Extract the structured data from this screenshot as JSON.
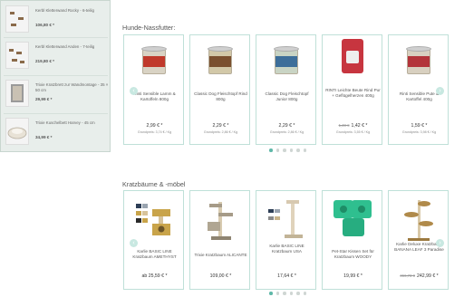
{
  "sidebar": {
    "items": [
      {
        "name": "Kerbl Kletterwand Rocky - 6-teilig",
        "price": "106,80 € *"
      },
      {
        "name": "Kerbl Kletterwand Anden - 7-teilig",
        "price": "219,80 € *"
      },
      {
        "name": "Trixie Kratzbrett zur Wandmontage - 35 × 50 cm",
        "price": "29,99 € *"
      },
      {
        "name": "Trixie Kuschelbett Harvey - 45 cm",
        "price": "34,99 € *"
      }
    ]
  },
  "sections": {
    "wet_food_title": "Hunde-Nassfutter:",
    "cat_trees_title": "Kratzbäume & -möbel"
  },
  "wet_food": [
    {
      "name": "Rinti Sensible Lamm & Kartoffeln 800g",
      "price": "2,99 € *",
      "sub": "Grundpreis: 3,74 € / Kg"
    },
    {
      "name": "Classic Dog Fleischtopf Rind 800g",
      "price": "2,29 € *",
      "sub": "Grundpreis: 2,86 € / Kg"
    },
    {
      "name": "Classic Dog Fleischtopf Junior 800g",
      "price": "2,29 € *",
      "sub": "Grundpreis: 2,86 € / Kg"
    },
    {
      "name": "RINTI Leichte Beute Rind Pur + Geflügelherzen 400g",
      "old_price": "1,49 €",
      "price": "1,42 € *",
      "sub": "Grundpreis: 3,55 € / Kg"
    },
    {
      "name": "Rinti Sensible Pute & Kartoffel 400g",
      "price": "1,59 € *",
      "sub": "Grundpreis: 3,98 € / Kg"
    }
  ],
  "cat_trees": [
    {
      "name": "Karlie BASIC LINE Kratzbaum AMETHYST",
      "price": "ab 25,59 € *"
    },
    {
      "name": "Trixie Kratzbaum ALICANTE",
      "price": "109,00 € *"
    },
    {
      "name": "Karlie BASIC LINE Kratzbaum USA",
      "price": "17,64 € *"
    },
    {
      "name": "Pet-Star Kissen Set für Kratzbaum WOODY",
      "price": "19,99 € *"
    },
    {
      "name": "Karlie Deluxe Kratzbaum BANANA LEAF 3 Paradise",
      "old_price": "456,73 €",
      "price": "242,99 € *"
    }
  ],
  "nav": {
    "prev": "‹",
    "next": "›"
  },
  "colors": {
    "accent": "#5fb8a8",
    "card_border": "#bfe0d8",
    "sidebar_bg": "#e8eeeb"
  }
}
